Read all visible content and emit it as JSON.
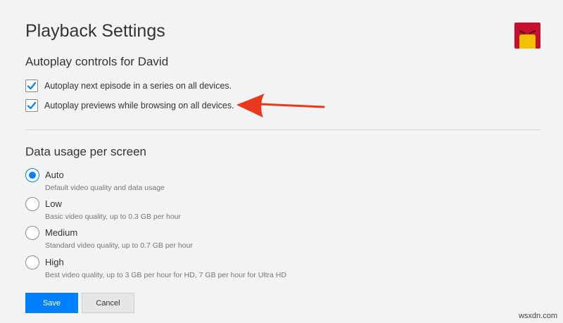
{
  "page": {
    "title": "Playback Settings",
    "avatar_icon": "profile-avatar-icon"
  },
  "autoplay": {
    "heading": "Autoplay controls for David",
    "options": [
      {
        "label": "Autoplay next episode in a series on all devices.",
        "checked": true
      },
      {
        "label": "Autoplay previews while browsing on all devices.",
        "checked": true
      }
    ]
  },
  "data_usage": {
    "heading": "Data usage per screen",
    "selected": "Auto",
    "options": [
      {
        "label": "Auto",
        "description": "Default video quality and data usage"
      },
      {
        "label": "Low",
        "description": "Basic video quality, up to 0.3 GB per hour"
      },
      {
        "label": "Medium",
        "description": "Standard video quality, up to 0.7 GB per hour"
      },
      {
        "label": "High",
        "description": "Best video quality, up to 3 GB per hour for HD, 7 GB per hour for Ultra HD"
      }
    ]
  },
  "actions": {
    "save_label": "Save",
    "cancel_label": "Cancel"
  },
  "annotation": {
    "arrow_color": "#e8391d"
  },
  "watermark": "wsxdn.com",
  "colors": {
    "accent": "#0080ff",
    "background": "#f3f3f3"
  }
}
